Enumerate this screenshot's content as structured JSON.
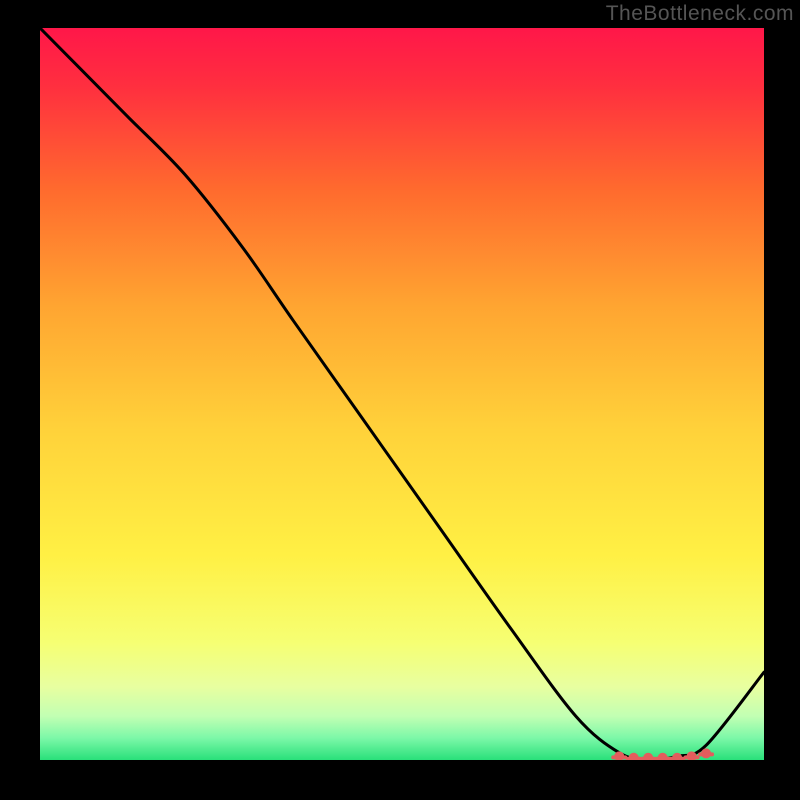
{
  "watermark": "TheBottleneck.com",
  "chart_data": {
    "type": "line",
    "title": "",
    "xlabel": "",
    "ylabel": "",
    "xlim": [
      0,
      100
    ],
    "ylim": [
      0,
      100
    ],
    "series": [
      {
        "name": "curve",
        "x": [
          0,
          5,
          12,
          20,
          28,
          35,
          45,
          55,
          65,
          74,
          80,
          84,
          88,
          92,
          100
        ],
        "values": [
          100,
          95,
          88,
          80,
          70,
          60,
          46,
          32,
          18,
          6,
          1,
          0,
          0.5,
          2,
          12
        ]
      }
    ],
    "markers": {
      "name": "highlight-cluster",
      "x": [
        80,
        82,
        84,
        86,
        88,
        90,
        92
      ],
      "y": [
        0.5,
        0.3,
        0.3,
        0.3,
        0.3,
        0.5,
        0.9
      ],
      "color": "#e35d5d"
    },
    "gradient_stops": [
      {
        "offset": 0,
        "color": "#ff1749"
      },
      {
        "offset": 0.08,
        "color": "#ff2f3f"
      },
      {
        "offset": 0.22,
        "color": "#ff6a2e"
      },
      {
        "offset": 0.38,
        "color": "#ffa531"
      },
      {
        "offset": 0.55,
        "color": "#ffd23a"
      },
      {
        "offset": 0.72,
        "color": "#fff044"
      },
      {
        "offset": 0.84,
        "color": "#f6ff73"
      },
      {
        "offset": 0.9,
        "color": "#e8ffa0"
      },
      {
        "offset": 0.94,
        "color": "#c2ffb3"
      },
      {
        "offset": 0.97,
        "color": "#7cf8a8"
      },
      {
        "offset": 1.0,
        "color": "#29e07a"
      }
    ]
  }
}
